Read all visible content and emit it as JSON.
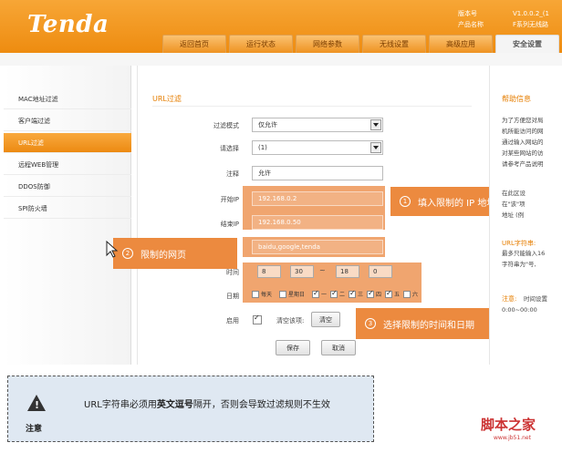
{
  "header": {
    "logo": "Tenda",
    "meta_labels": [
      "版本号",
      "产品名称"
    ],
    "meta_values": [
      "V1.0.0.2_(1",
      "F系列无线路"
    ],
    "tabs": [
      "返回首页",
      "运行状态",
      "网络参数",
      "无线设置",
      "高级应用",
      "安全设置"
    ],
    "active_tab": "安全设置"
  },
  "sidebar": {
    "items": [
      "MAC地址过滤",
      "客户端过滤",
      "URL过滤",
      "远程WEB管理",
      "DDOS防御",
      "SPI防火墙"
    ],
    "active": "URL过滤"
  },
  "form": {
    "title": "URL过滤",
    "filter_mode_label": "过滤模式",
    "filter_mode_value": "仅允许",
    "select_label": "请选择",
    "select_value": "(1)",
    "note_label": "注释",
    "note_value": "允许",
    "start_ip_label": "开始IP",
    "start_ip_value": "192.168.0.2",
    "end_ip_label": "结束IP",
    "end_ip_value": "192.168.0.50",
    "url_value": "baidu,google,tenda",
    "time_label": "时间",
    "time_start_h": "8",
    "time_start_m": "30",
    "tilde": "~",
    "time_end_h": "18",
    "time_end_m": "0",
    "date_label": "日期",
    "days": [
      {
        "label": "每天",
        "checked": false
      },
      {
        "label": "星期日",
        "checked": false
      },
      {
        "label": "一",
        "checked": true
      },
      {
        "label": "二",
        "checked": true
      },
      {
        "label": "三",
        "checked": true
      },
      {
        "label": "四",
        "checked": true
      },
      {
        "label": "五",
        "checked": true
      },
      {
        "label": "六",
        "checked": false
      }
    ],
    "enable_label": "启用",
    "clear_label": "清空该项:",
    "clear_button": "清空",
    "save_button": "保存",
    "cancel_button": "取消"
  },
  "callouts": {
    "c1_num": "1",
    "c1_text": "填入限制的 IP 地址段",
    "c2_num": "2",
    "c2_text": "限制的网页",
    "c3_num": "3",
    "c3_text": "选择限制的时间和日期"
  },
  "help": {
    "title": "帮助信息",
    "lines": [
      "为了方便您对局",
      "机所能访问的网",
      "通过输入网站的",
      "对某些网站的访",
      "请参考产品说明"
    ],
    "lines2": [
      "在此区设",
      "在\"该\"项",
      "地址 (例"
    ],
    "urlstr_title": "URL字符串:",
    "urlstr_lines": [
      "最多只能输入16",
      "字符串为\"号,"
    ],
    "note_title": "注意:",
    "note_lines": [
      "时间设置",
      "0:00~00:00"
    ]
  },
  "note_box": {
    "label": "注意",
    "text_before": "URL字符串必须用",
    "text_bold": "英文逗号",
    "text_after": "隔开，否则会导致过滤规则不生效"
  },
  "watermark": {
    "site": "脚本之家",
    "url": "www.jb51.net"
  }
}
